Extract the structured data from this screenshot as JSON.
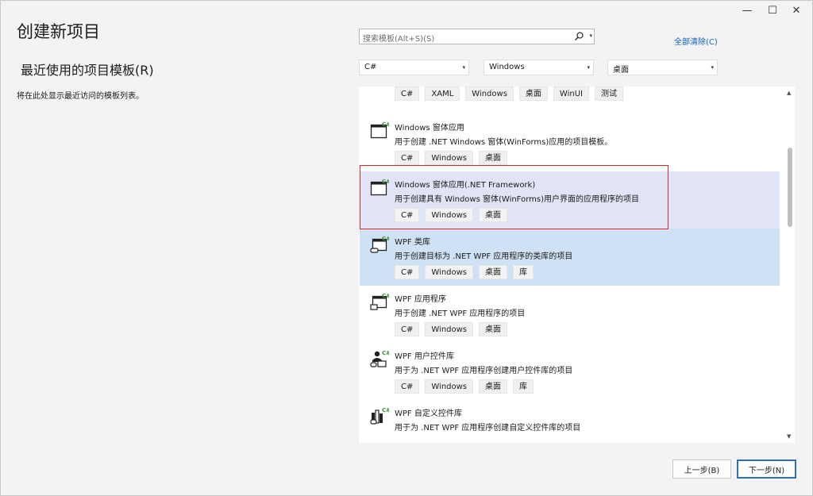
{
  "window": {
    "title": "创建新项目",
    "minimize": "—",
    "maximize": "☐",
    "close": "✕"
  },
  "recent": {
    "heading": "最近使用的项目模板(R)",
    "empty_text": "将在此处显示最近访问的模板列表。"
  },
  "search": {
    "placeholder": "搜索模板(Alt+S)(S)",
    "icon": "search-icon",
    "caret": "▾"
  },
  "clear_all": "全部清除(C)",
  "filters": {
    "language": "C#",
    "platform": "Windows",
    "project_type": "桌面",
    "caret": "▾"
  },
  "templates": [
    {
      "title": "",
      "desc": "",
      "tags": [
        "C#",
        "XAML",
        "Windows",
        "桌面",
        "WinUI",
        "测试"
      ],
      "icon": ""
    },
    {
      "title": "Windows 窗体应用",
      "desc": "用于创建 .NET Windows 窗体(WinForms)应用的项目模板。",
      "tags": [
        "C#",
        "Windows",
        "桌面"
      ],
      "icon": "winforms-icon"
    },
    {
      "title": "Windows 窗体应用(.NET Framework)",
      "desc": "用于创建具有 Windows 窗体(WinForms)用户界面的应用程序的项目",
      "tags": [
        "C#",
        "Windows",
        "桌面"
      ],
      "icon": "winforms-icon",
      "state": "hovered"
    },
    {
      "title": "WPF 类库",
      "desc": "用于创建目标为 .NET WPF 应用程序的类库的项目",
      "tags": [
        "C#",
        "Windows",
        "桌面",
        "库"
      ],
      "icon": "wpf-library-icon",
      "state": "selected"
    },
    {
      "title": "WPF 应用程序",
      "desc": "用于创建 .NET WPF 应用程序的项目",
      "tags": [
        "C#",
        "Windows",
        "桌面"
      ],
      "icon": "wpf-app-icon"
    },
    {
      "title": "WPF 用户控件库",
      "desc": "用于为 .NET WPF 应用程序创建用户控件库的项目",
      "tags": [
        "C#",
        "Windows",
        "桌面",
        "库"
      ],
      "icon": "wpf-user-control-icon"
    },
    {
      "title": "WPF 自定义控件库",
      "desc": "用于为 .NET WPF 应用程序创建自定义控件库的项目",
      "tags": [],
      "icon": "wpf-custom-control-icon"
    }
  ],
  "scrollbar": {
    "up": "▲",
    "down": "▼"
  },
  "buttons": {
    "back": "上一步(B)",
    "next": "下一步(N)"
  },
  "colors": {
    "accent": "#0b63c4",
    "selected_bg": "#cfe1f5",
    "hover_bg": "#e1e3f6",
    "highlight": "#e0252b",
    "csharp_badge": "#3a8f3a"
  }
}
